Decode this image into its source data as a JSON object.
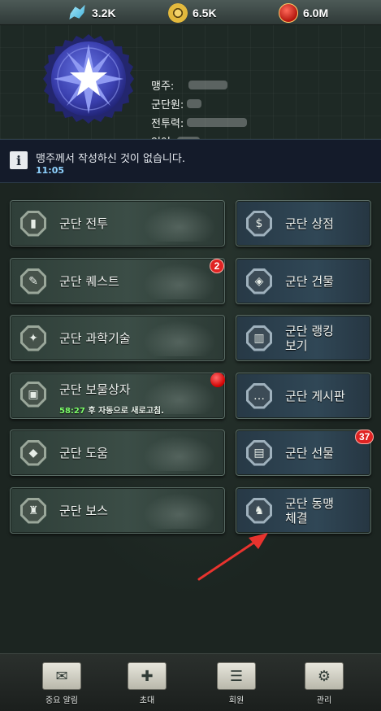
{
  "resources": [
    {
      "name": "crystal",
      "icon": "crystal-icon",
      "value": "3.2K"
    },
    {
      "name": "gold",
      "icon": "gear-coin-icon",
      "value": "6.5K"
    },
    {
      "name": "power",
      "icon": "power-badge-icon",
      "value": "6.0M"
    }
  ],
  "alliance": {
    "labels": {
      "leader": "맹주:",
      "members": "군단원:",
      "power": "전투력:",
      "language": "언어:"
    }
  },
  "notice": {
    "icon": "info-icon",
    "text": "맹주께서 작성하신 것이 없습니다.",
    "time": "11:05"
  },
  "menu": {
    "battle": {
      "label": "군단 전투",
      "icon": "bullet-icon"
    },
    "shop": {
      "label": "군단 상점",
      "icon": "money-bag-icon"
    },
    "quest": {
      "label": "군단 퀘스트",
      "icon": "scroll-pen-icon",
      "badge": "2"
    },
    "building": {
      "label": "군단 건물",
      "icon": "cube-icon"
    },
    "tech": {
      "label": "군단 과학기술",
      "icon": "satellite-icon"
    },
    "ranking": {
      "label_line1": "군단 랭킹",
      "label_line2": "보기",
      "icon": "ranking-bars-icon"
    },
    "treasure": {
      "label": "군단 보물상자",
      "icon": "chest-icon",
      "refresh_time": "58:27",
      "refresh_text": "후 자동으로 새로고침."
    },
    "board": {
      "label": "군단 게시판",
      "icon": "chat-bubble-icon"
    },
    "help": {
      "label": "군단 도움",
      "icon": "handshake-icon"
    },
    "gift": {
      "label": "군단 선물",
      "icon": "gift-box-icon",
      "badge": "37"
    },
    "boss": {
      "label": "군단 보스",
      "icon": "soldier-icon"
    },
    "alliance": {
      "label_line1": "군단 동맹",
      "label_line2": "체결",
      "icon": "allies-icon"
    }
  },
  "bottom_nav": [
    {
      "label": "중요 알림",
      "icon": "mail-group-icon"
    },
    {
      "label": "초대",
      "icon": "add-member-icon"
    },
    {
      "label": "회원",
      "icon": "member-card-icon"
    },
    {
      "label": "관리",
      "icon": "manage-gear-icon"
    }
  ],
  "colors": {
    "badge_red": "#e02323",
    "notice_time": "#8fd3ff",
    "refresh_green": "#7dff6a",
    "arrow_red": "#e8332e"
  }
}
